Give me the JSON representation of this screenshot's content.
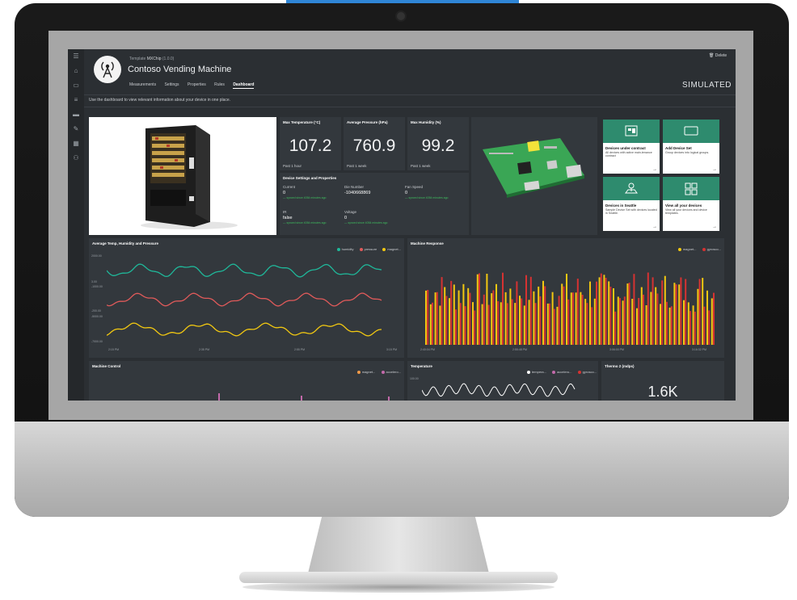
{
  "header": {
    "breadcrumb_prefix": "Template",
    "breadcrumb_name": "MXChip",
    "breadcrumb_version": "(1.0.0)",
    "device_title": "Contoso Vending Machine",
    "delete_label": "Delete",
    "status": "SIMULATED",
    "tabs": [
      {
        "label": "Measurements",
        "active": false
      },
      {
        "label": "Settings",
        "active": false
      },
      {
        "label": "Properties",
        "active": false
      },
      {
        "label": "Rules",
        "active": false
      },
      {
        "label": "Dashboard",
        "active": true
      }
    ]
  },
  "info_text": "Use the dashboard to view relevant information about your device in one place.",
  "sidebar_icons": [
    "menu-icon",
    "home-icon",
    "devices-icon",
    "list-icon",
    "folder-icon",
    "wrench-icon",
    "grid-icon",
    "users-icon"
  ],
  "kpis": [
    {
      "title": "Max Temperature (°C)",
      "value": "107.2",
      "period": "Past 1 hour"
    },
    {
      "title": "Average Pressure (hPa)",
      "value": "760.9",
      "period": "Past 1 week"
    },
    {
      "title": "Max Humidity (%)",
      "value": "99.2",
      "period": "Past 1 week"
    }
  ],
  "settings": {
    "title": "Device Settings and Properties",
    "items": [
      {
        "label": "Current",
        "value": "0",
        "note": "— synced since 4054 minutes ago"
      },
      {
        "label": "Die Number",
        "value": "-1040668869",
        "note": ""
      },
      {
        "label": "Fan Speed",
        "value": "0",
        "note": "— synced since 4054 minutes ago"
      },
      {
        "label": "IR",
        "value": "false",
        "note": "— synced since 4054 minutes ago"
      },
      {
        "label": "Voltage",
        "value": "0",
        "note": "— synced since 4054 minutes ago"
      }
    ]
  },
  "cards": [
    {
      "title": "Devices under contract",
      "desc": "All devices with active main-tenance contract",
      "icon": "device-icon"
    },
    {
      "title": "Add Device Set",
      "desc": "Group devices into logical groups.",
      "icon": "tablet-icon"
    },
    {
      "title": "Devices in Seattle",
      "desc": "Sample Device Set with devices located in Seattle.",
      "icon": "map-pin-icon"
    },
    {
      "title": "View all your devices",
      "desc": "View all your devices and device templates.",
      "icon": "devices-grid-icon"
    }
  ],
  "chart_data": [
    {
      "type": "line",
      "title": "Average Temp, Humidity and Pressure",
      "series": [
        {
          "name": "humidity",
          "color": "#1fb89a"
        },
        {
          "name": "pressure",
          "color": "#e05a5a"
        },
        {
          "name": "magnet...",
          "color": "#f2c811"
        }
      ],
      "x_ticks": [
        "2:15 PM",
        "2:35 PM",
        "2:55 PM",
        "3:15 PM"
      ],
      "y_ticks": [
        "2000.00",
        "3.00",
        "-1000.00",
        "-200.00",
        "-5000.00",
        "-7000.00"
      ],
      "grid": false,
      "legend": "top-right"
    },
    {
      "type": "bar",
      "title": "Machine Response",
      "series": [
        {
          "name": "magnet...",
          "color": "#f2c811"
        },
        {
          "name": "gyrosco...",
          "color": "#d63232"
        }
      ],
      "x_ticks": [
        "2:40:04 PM",
        "2:55:48 PM",
        "3:06:00 PM",
        "3:16:32 PM"
      ],
      "legend": "top-right"
    },
    {
      "type": "bar",
      "title": "Machine Control",
      "series": [
        {
          "name": "magnet...",
          "color": "#f09a48"
        },
        {
          "name": "accelero...",
          "color": "#c36aaa"
        }
      ],
      "legend": "top-right"
    },
    {
      "type": "line",
      "title": "Temperature",
      "series": [
        {
          "name": "tempera...",
          "color": "#ffffff"
        },
        {
          "name": "accelero...",
          "color": "#c36aaa"
        },
        {
          "name": "gyrosco...",
          "color": "#d63232"
        }
      ],
      "y_ticks": [
        "100.00"
      ],
      "legend": "top-right"
    }
  ],
  "thermo": {
    "title": "Thermo 2 (mdps)",
    "value": "1.6K"
  }
}
